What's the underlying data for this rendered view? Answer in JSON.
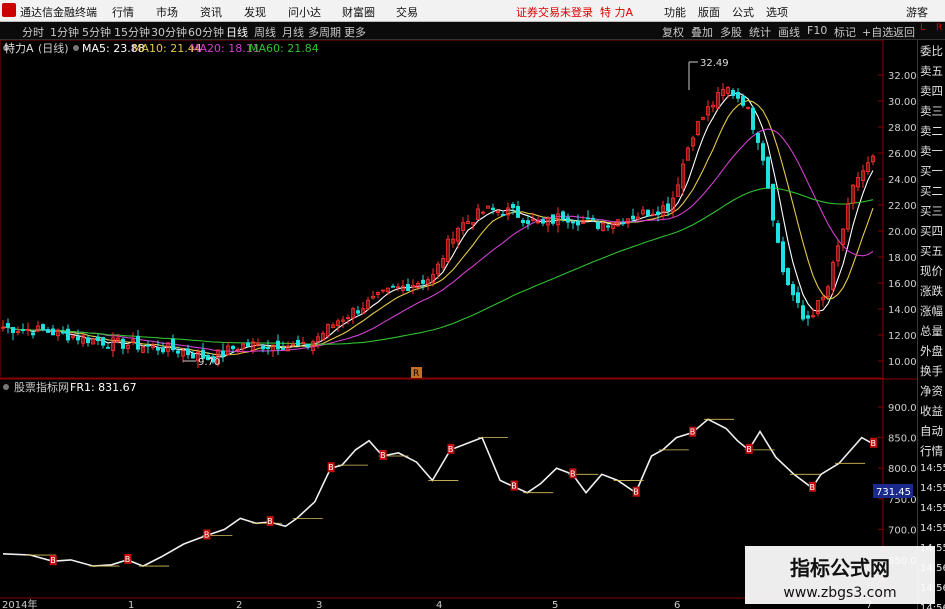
{
  "topbar": {
    "app_title": "通达信金融终端",
    "menus": [
      "行情",
      "市场",
      "资讯",
      "发现",
      "问小达",
      "财富圈",
      "交易"
    ],
    "warning": "证券交易未登录",
    "stock": "特 力A",
    "right_buttons": [
      "功能",
      "版面",
      "公式",
      "选项"
    ],
    "guest": "游客"
  },
  "toolbar": {
    "periods": [
      "分时",
      "1分钟",
      "5分钟",
      "15分钟",
      "30分钟",
      "60分钟",
      "日线",
      "周线",
      "月线",
      "多周期",
      "更多"
    ],
    "active_period": "日线",
    "right_buttons": [
      "复权",
      "叠加",
      "多股",
      "统计",
      "画线",
      "F10",
      "标记",
      "+自选",
      "返回"
    ]
  },
  "main_chart": {
    "stock_name": "特力A",
    "period_label": "(日线)",
    "ma": [
      {
        "label": "MA5: 23.88",
        "color": "#ffffff"
      },
      {
        "label": "MA10: 21.44",
        "color": "#e6c84a"
      },
      {
        "label": "MA20: 18.11",
        "color": "#d040d0"
      },
      {
        "label": "MA60: 21.84",
        "color": "#30c030"
      }
    ],
    "high_label": "32.49",
    "low_label": "9.70",
    "y_ticks": [
      "32.00",
      "30.00",
      "28.00",
      "26.00",
      "24.00",
      "22.00",
      "20.00",
      "18.00",
      "16.00",
      "14.00",
      "12.00",
      "10.00"
    ],
    "marker": "R"
  },
  "sub_chart": {
    "name": "股票指标网",
    "value": "FR1: 831.67",
    "y_ticks": [
      "900.0",
      "850.0",
      "800.0",
      "750.0",
      "700.0",
      "650.0"
    ],
    "current_value": "731.45",
    "signal_mark": "B"
  },
  "x_axis": {
    "labels": [
      "2014年",
      "1",
      "2",
      "3",
      "4",
      "5",
      "6",
      "7"
    ]
  },
  "right_panel": {
    "corner": [
      "L",
      "R"
    ],
    "items": [
      "委比",
      "卖五",
      "卖四",
      "卖三",
      "卖二",
      "卖一",
      "买一",
      "买二",
      "买三",
      "买四",
      "买五",
      "现价",
      "涨跌",
      "涨幅",
      "总量",
      "外盘",
      "换手",
      "净资",
      "收益",
      "自动",
      "行情",
      "14:55",
      "14:55",
      "14:55",
      "14:55",
      "14:55",
      "14:56",
      "14:56",
      "14:56"
    ]
  },
  "colors": {
    "up": "#ff3030",
    "down": "#20e0e0",
    "ma5": "#ffffff",
    "ma10": "#e6c84a",
    "ma20": "#d040d0",
    "ma60": "#30c030",
    "axis": "#a00000"
  },
  "watermark": {
    "line1": "指标公式网",
    "line2": "www.zbgs3.com"
  }
}
